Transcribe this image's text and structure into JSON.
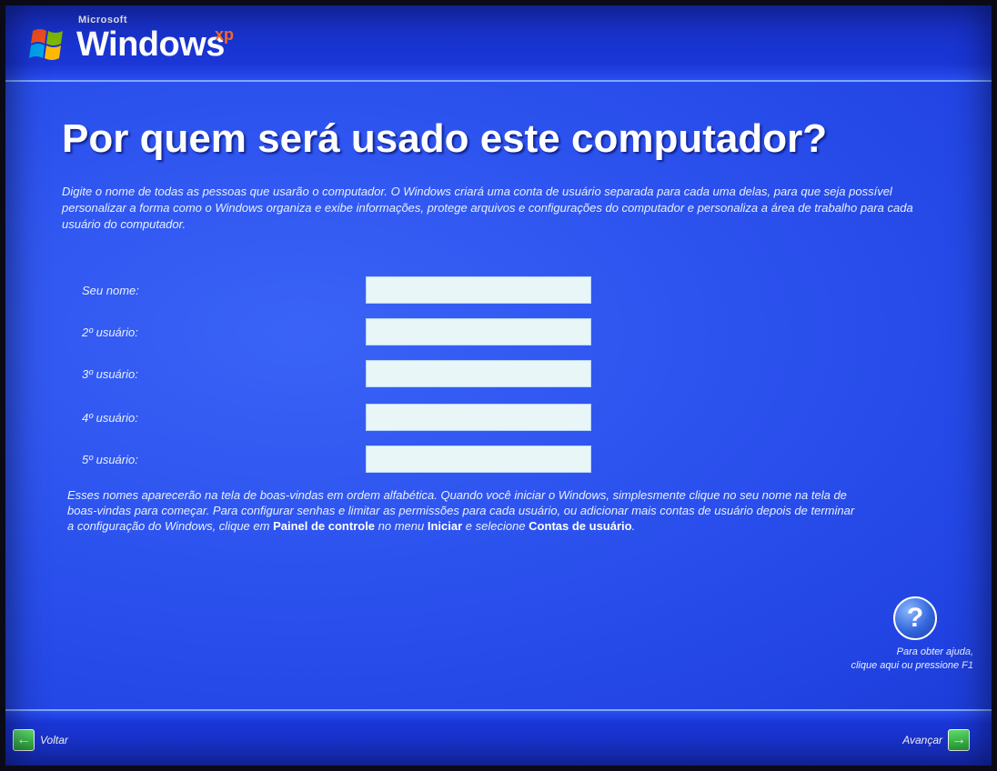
{
  "header": {
    "brand_small": "Microsoft",
    "brand_word": "Windows",
    "brand_suffix": "xp",
    "logo_icon": "windows-flag-icon"
  },
  "page": {
    "title": "Por quem será usado este computador?",
    "intro": "Digite o nome de todas as pessoas que usarão o computador. O Windows criará uma conta de usuário separada para cada uma delas, para que seja possível personalizar a forma como o Windows organiza e exibe informações, protege arquivos e configurações do computador e personaliza a área de trabalho para cada usuário do computador."
  },
  "form": {
    "fields": [
      {
        "label": "Seu nome:",
        "value": ""
      },
      {
        "label": "2º usuário:",
        "value": ""
      },
      {
        "label": "3º usuário:",
        "value": ""
      },
      {
        "label": "4º usuário:",
        "value": ""
      },
      {
        "label": "5º usuário:",
        "value": ""
      }
    ]
  },
  "outro": {
    "text_1": "Esses nomes aparecerão na tela de boas-vindas em ordem alfabética. Quando você iniciar o Windows, simplesmente clique no seu nome na tela de boas-vindas para começar. Para configurar senhas e limitar as permissões para cada usuário, ou adicionar mais contas de usuário depois de terminar a configuração do Windows, clique em ",
    "bold_1": "Painel de controle",
    "text_2": " no menu ",
    "bold_2": "Iniciar",
    "text_3": " e selecione ",
    "bold_3": "Contas de usuário",
    "text_4": "."
  },
  "help": {
    "icon": "help-question-icon",
    "line_1": "Para obter ajuda,",
    "line_2": "clique aqui ou pressione F1"
  },
  "nav": {
    "back_label": "Voltar",
    "back_icon": "arrow-left-icon",
    "next_label": "Avançar",
    "next_icon": "arrow-right-icon"
  },
  "colors": {
    "background": "#2c52ee",
    "bar": "#1830c8",
    "accent_xp": "#ff6a2a",
    "nav_arrow": "#2aa83a"
  }
}
